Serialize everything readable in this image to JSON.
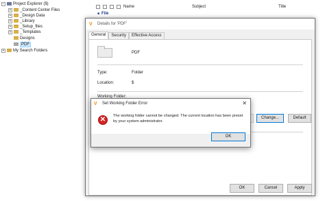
{
  "tree": {
    "items": [
      {
        "label": "Project Explorer ($)",
        "expander": "−",
        "icon": "drive"
      },
      {
        "label": "_Content Center Files",
        "expander": "+",
        "icon": "folder"
      },
      {
        "label": "_Design Data",
        "expander": "+",
        "icon": "folder"
      },
      {
        "label": "_Library",
        "expander": "+",
        "icon": "folder"
      },
      {
        "label": "_Setup_files",
        "expander": "+",
        "icon": "folder"
      },
      {
        "label": "_Templates",
        "expander": "+",
        "icon": "folder"
      },
      {
        "label": "Designs",
        "expander": "",
        "icon": "folder"
      },
      {
        "label": "PDF",
        "expander": "",
        "icon": "folder-gray",
        "selected": true
      },
      {
        "label": "My Search Folders",
        "expander": "+",
        "icon": "folder"
      }
    ]
  },
  "list": {
    "columns": {
      "name": "Name",
      "subject": "Subject",
      "title": "Title"
    },
    "group": "File"
  },
  "details": {
    "title": "Details for 'PDF'",
    "tabs": [
      "General",
      "Security",
      "Effective Access"
    ],
    "name": "PDF",
    "type_label": "Type:",
    "type_value": "Folder",
    "location_label": "Location:",
    "location_value": "$",
    "working_folder_label": "Working Folder:",
    "change_label": "Change...",
    "default_label": "Default",
    "ok_label": "OK",
    "cancel_label": "Cancel",
    "apply_label": "Apply"
  },
  "error": {
    "title": "Set Working Folder Error",
    "close_glyph": "✕",
    "message": "The working folder cannot be changed. The current location has been preset by your system administrator.",
    "ok_label": "OK"
  },
  "colors": {
    "accent": "#0078d7",
    "vault": "#ef8b00",
    "error": "#d42525"
  }
}
